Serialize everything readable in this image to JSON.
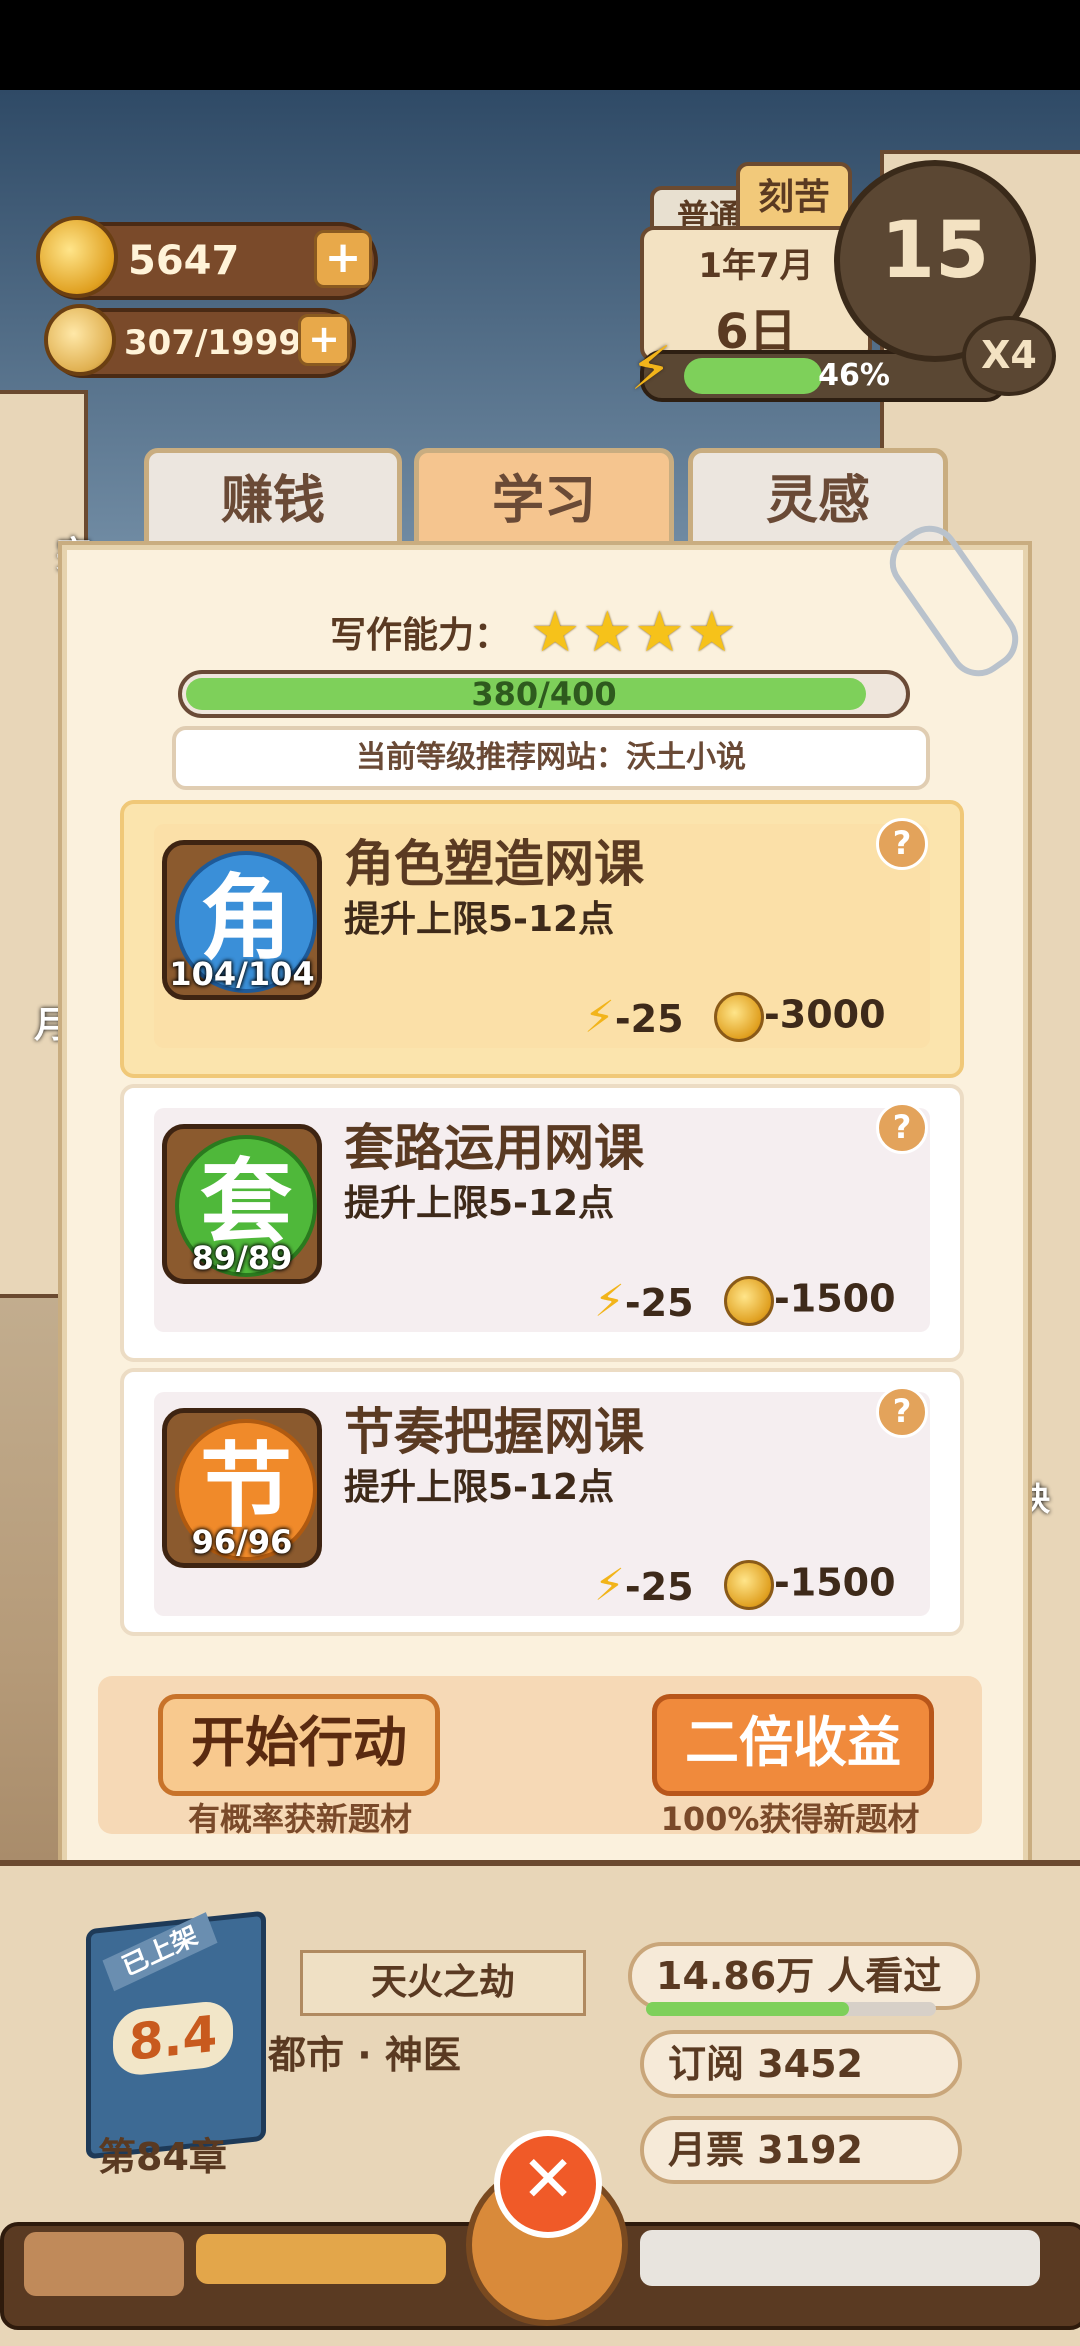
{
  "hud": {
    "coins": "5647",
    "ideas": "307/1999",
    "plus": "+",
    "difficulty_tabs": [
      "普通",
      "刻苦"
    ],
    "month": "1年7月",
    "day": "6日",
    "energy_percent_label": "46%",
    "energy_percent": 46,
    "timer": "15",
    "speed": "X4"
  },
  "side_labels": {
    "left_top": "完",
    "left_mid": "月",
    "right_mid": "快"
  },
  "tabs": [
    {
      "label": "赚钱",
      "active": false
    },
    {
      "label": "学习",
      "active": true
    },
    {
      "label": "灵感",
      "active": false
    }
  ],
  "ability": {
    "label": "写作能力：",
    "stars": 4,
    "progress_text": "380/400",
    "progress": 0.95,
    "recommend": "当前等级推荐网站：沃土小说"
  },
  "courses": [
    {
      "icon_char": "角",
      "icon_color": "#3a8fd8",
      "count": "104/104",
      "title": "角色塑造网课",
      "desc": "提升上限5-12点",
      "energy_cost": "-25",
      "coin_cost": "-3000",
      "selected": true
    },
    {
      "icon_char": "套",
      "icon_color": "#4fb83a",
      "count": "89/89",
      "title": "套路运用网课",
      "desc": "提升上限5-12点",
      "energy_cost": "-25",
      "coin_cost": "-1500",
      "selected": false
    },
    {
      "icon_char": "节",
      "icon_color": "#f08a2a",
      "count": "96/96",
      "title": "节奏把握网课",
      "desc": "提升上限5-12点",
      "energy_cost": "-25",
      "coin_cost": "-1500",
      "selected": false
    }
  ],
  "actions": {
    "start_label": "开始行动",
    "start_sub": "有概率获新题材",
    "double_label": "二倍收益",
    "double_sub": "100%获得新题材"
  },
  "book": {
    "status_badge": "已上架",
    "rating": "8.4",
    "title": "天火之劫",
    "genre": "都市 · 神医",
    "chapter": "第84章",
    "views": "14.86万 人看过",
    "subscriptions": "订阅 3452",
    "monthly_tickets": "月票 3192"
  },
  "close_icon_name": "close-icon"
}
